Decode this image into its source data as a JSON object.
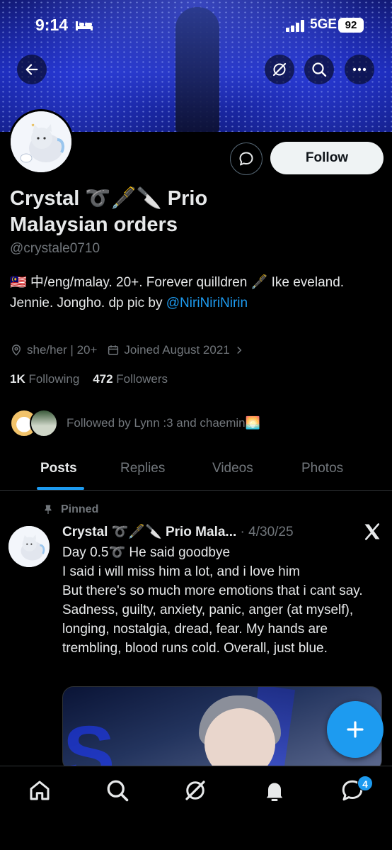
{
  "status_bar": {
    "time": "9:14",
    "network": "5GE",
    "battery": "92"
  },
  "profile": {
    "display_name": "Crystal ➰🖋️🔪 Prio Malaysian orders",
    "handle": "@crystale0710",
    "bio_text": "🇲🇾 中/eng/malay. 20+. Forever quilldren 🖋️ Ike eveland. Jennie. Jongho. dp pic by ",
    "bio_link": "@NiriNiriNirin",
    "pronouns": "she/her | 20+",
    "joined": "Joined August 2021",
    "following_count": "1K",
    "following_label": "Following",
    "followers_count": "472",
    "followers_label": "Followers",
    "followed_by": "Followed by Lynn :3 and chaemin🌅"
  },
  "actions": {
    "follow_label": "Follow"
  },
  "tabs": [
    {
      "label": "Posts"
    },
    {
      "label": "Replies"
    },
    {
      "label": "Videos"
    },
    {
      "label": "Photos"
    }
  ],
  "pinned_post": {
    "pinned_label": "Pinned",
    "author": "Crystal ➰🖋️🔪 Prio Mala...",
    "date": " · 4/30/25",
    "text": "Day 0.5➰ He said goodbye\nI said i will miss him a lot, and i love him\nBut there's so much more emotions that i cant say. Sadness, guilty, anxiety, panic, anger (at myself), longing, nostalgia, dread, fear. My hands are trembling, blood runs cold. Overall, just blue."
  },
  "bottom_nav": {
    "messages_badge": "4"
  },
  "colors": {
    "accent": "#1d9bf0",
    "background": "#000000",
    "muted": "#71767b"
  }
}
